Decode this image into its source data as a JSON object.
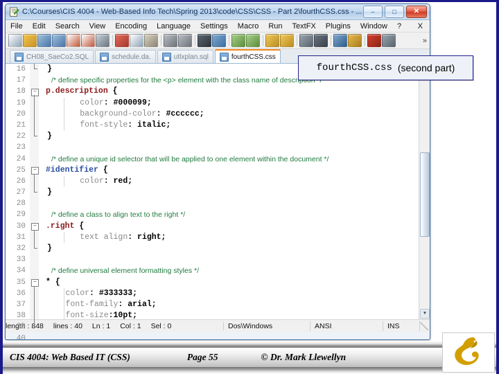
{
  "window": {
    "title": "C:\\Courses\\CIS 4004 - Web-Based Info Tech\\Spring 2013\\code\\CSS\\CSS - Part 2\\fourthCSS.css - ...",
    "app_icon": "notepad-plus-plus-icon",
    "buttons": {
      "minimize": "–",
      "maximize": "□",
      "close": "✕"
    }
  },
  "menu": {
    "items": [
      "File",
      "Edit",
      "Search",
      "View",
      "Encoding",
      "Language",
      "Settings",
      "Macro",
      "Run",
      "TextFX",
      "Plugins",
      "Window",
      "?"
    ],
    "close_document": "X"
  },
  "toolbar": {
    "overflow_chevron": "»",
    "icons": [
      "new-file-icon",
      "open-file-icon",
      "save-icon",
      "save-all-icon",
      "close-file-icon",
      "close-all-icon",
      "print-icon",
      "cut-icon",
      "copy-icon",
      "paste-icon",
      "undo-icon",
      "redo-icon",
      "find-icon",
      "replace-icon",
      "zoom-in-icon",
      "zoom-out-icon",
      "sync-vertical-icon",
      "sync-horizontal-icon",
      "word-wrap-icon",
      "show-all-chars-icon",
      "indent-guide-icon",
      "user-defined-dialog-icon",
      "record-macro-icon",
      "stop-macro-icon"
    ]
  },
  "tabs": [
    {
      "label": "CH08_SaeCo2.SQL",
      "active": false
    },
    {
      "label": "schedule.da.",
      "active": false
    },
    {
      "label": "utlxplan.sql",
      "active": false
    },
    {
      "label": "fourthCSS.css",
      "active": true
    }
  ],
  "editor": {
    "first_line": 16,
    "lines": [
      {
        "n": 16,
        "tokens": [
          {
            "t": "}",
            "c": "brace"
          }
        ]
      },
      {
        "n": 17,
        "tokens": [
          {
            "t": "/* define specific properties for the <p> element with the class name of description */",
            "c": "cmt"
          }
        ]
      },
      {
        "n": 18,
        "tokens": [
          {
            "t": "p.description ",
            "c": "sel"
          },
          {
            "t": "{",
            "c": "brace"
          }
        ]
      },
      {
        "n": 19,
        "tokens": [
          {
            "t": "        color",
            "c": "prop"
          },
          {
            "t": ": ",
            "c": "brace"
          },
          {
            "t": "#000099;",
            "c": "val"
          }
        ]
      },
      {
        "n": 20,
        "tokens": [
          {
            "t": "        background-color",
            "c": "prop"
          },
          {
            "t": ": ",
            "c": "brace"
          },
          {
            "t": "#cccccc;",
            "c": "val"
          }
        ]
      },
      {
        "n": 21,
        "tokens": [
          {
            "t": "        font-style",
            "c": "prop"
          },
          {
            "t": ": ",
            "c": "brace"
          },
          {
            "t": "italic;",
            "c": "val"
          }
        ]
      },
      {
        "n": 22,
        "tokens": [
          {
            "t": "}",
            "c": "brace"
          }
        ]
      },
      {
        "n": 23,
        "tokens": []
      },
      {
        "n": 24,
        "tokens": [
          {
            "t": "/* define a unique id selector that will be applied to one element within the document */",
            "c": "cmt"
          }
        ]
      },
      {
        "n": 25,
        "tokens": [
          {
            "t": "#identifier ",
            "c": "sel-id"
          },
          {
            "t": "{",
            "c": "brace"
          }
        ]
      },
      {
        "n": 26,
        "tokens": [
          {
            "t": "        color",
            "c": "prop"
          },
          {
            "t": ": ",
            "c": "brace"
          },
          {
            "t": "red;",
            "c": "val"
          }
        ]
      },
      {
        "n": 27,
        "tokens": [
          {
            "t": "}",
            "c": "brace"
          }
        ]
      },
      {
        "n": 28,
        "tokens": []
      },
      {
        "n": 29,
        "tokens": [
          {
            "t": "/* define a class to align text to the right */",
            "c": "cmt"
          }
        ]
      },
      {
        "n": 30,
        "tokens": [
          {
            "t": ".right ",
            "c": "sel"
          },
          {
            "t": "{",
            "c": "brace"
          }
        ]
      },
      {
        "n": 31,
        "tokens": [
          {
            "t": "        text align",
            "c": "prop"
          },
          {
            "t": ": ",
            "c": "brace"
          },
          {
            "t": "right;",
            "c": "val"
          }
        ]
      },
      {
        "n": 32,
        "tokens": [
          {
            "t": "}",
            "c": "brace"
          }
        ]
      },
      {
        "n": 33,
        "tokens": []
      },
      {
        "n": 34,
        "tokens": [
          {
            "t": "/* define universal element formatting styles */",
            "c": "cmt"
          }
        ]
      },
      {
        "n": 35,
        "tokens": [
          {
            "t": "* ",
            "c": "brace"
          },
          {
            "t": "{",
            "c": "brace"
          }
        ]
      },
      {
        "n": 36,
        "tokens": [
          {
            "t": "     color",
            "c": "prop"
          },
          {
            "t": ": ",
            "c": "brace"
          },
          {
            "t": "#333333;",
            "c": "val"
          }
        ]
      },
      {
        "n": 37,
        "tokens": [
          {
            "t": "     font-family",
            "c": "prop"
          },
          {
            "t": ": ",
            "c": "brace"
          },
          {
            "t": "arial;",
            "c": "val"
          }
        ]
      },
      {
        "n": 38,
        "tokens": [
          {
            "t": "     font-size",
            "c": "prop"
          },
          {
            "t": ":",
            "c": "brace"
          },
          {
            "t": "10pt;",
            "c": "val"
          }
        ]
      },
      {
        "n": 39,
        "tokens": [
          {
            "t": "}",
            "c": "brace"
          }
        ]
      },
      {
        "n": 40,
        "tokens": []
      }
    ]
  },
  "statusbar": {
    "length_label": "length : 848",
    "lines_label": "lines : 40",
    "ln": "Ln : 1",
    "col": "Col : 1",
    "sel": "Sel : 0",
    "eol": "Dos\\Windows",
    "encoding": "ANSI",
    "insert_mode": "INS"
  },
  "callout": {
    "filename": "fourthCSS.css",
    "note": "(second part)"
  },
  "footer": {
    "course": "CIS 4004: Web Based IT (CSS)",
    "page": "Page 55",
    "copyright": "© Dr. Mark Llewellyn"
  },
  "colors": {
    "accent_blue": "#1a1a8c",
    "active_tab_top": "#f08a20",
    "comment_green": "#1f7a3d",
    "selector_red": "#8b1a1a",
    "id_selector_blue": "#2b4fa0",
    "logo_gold": "#d39f00"
  }
}
